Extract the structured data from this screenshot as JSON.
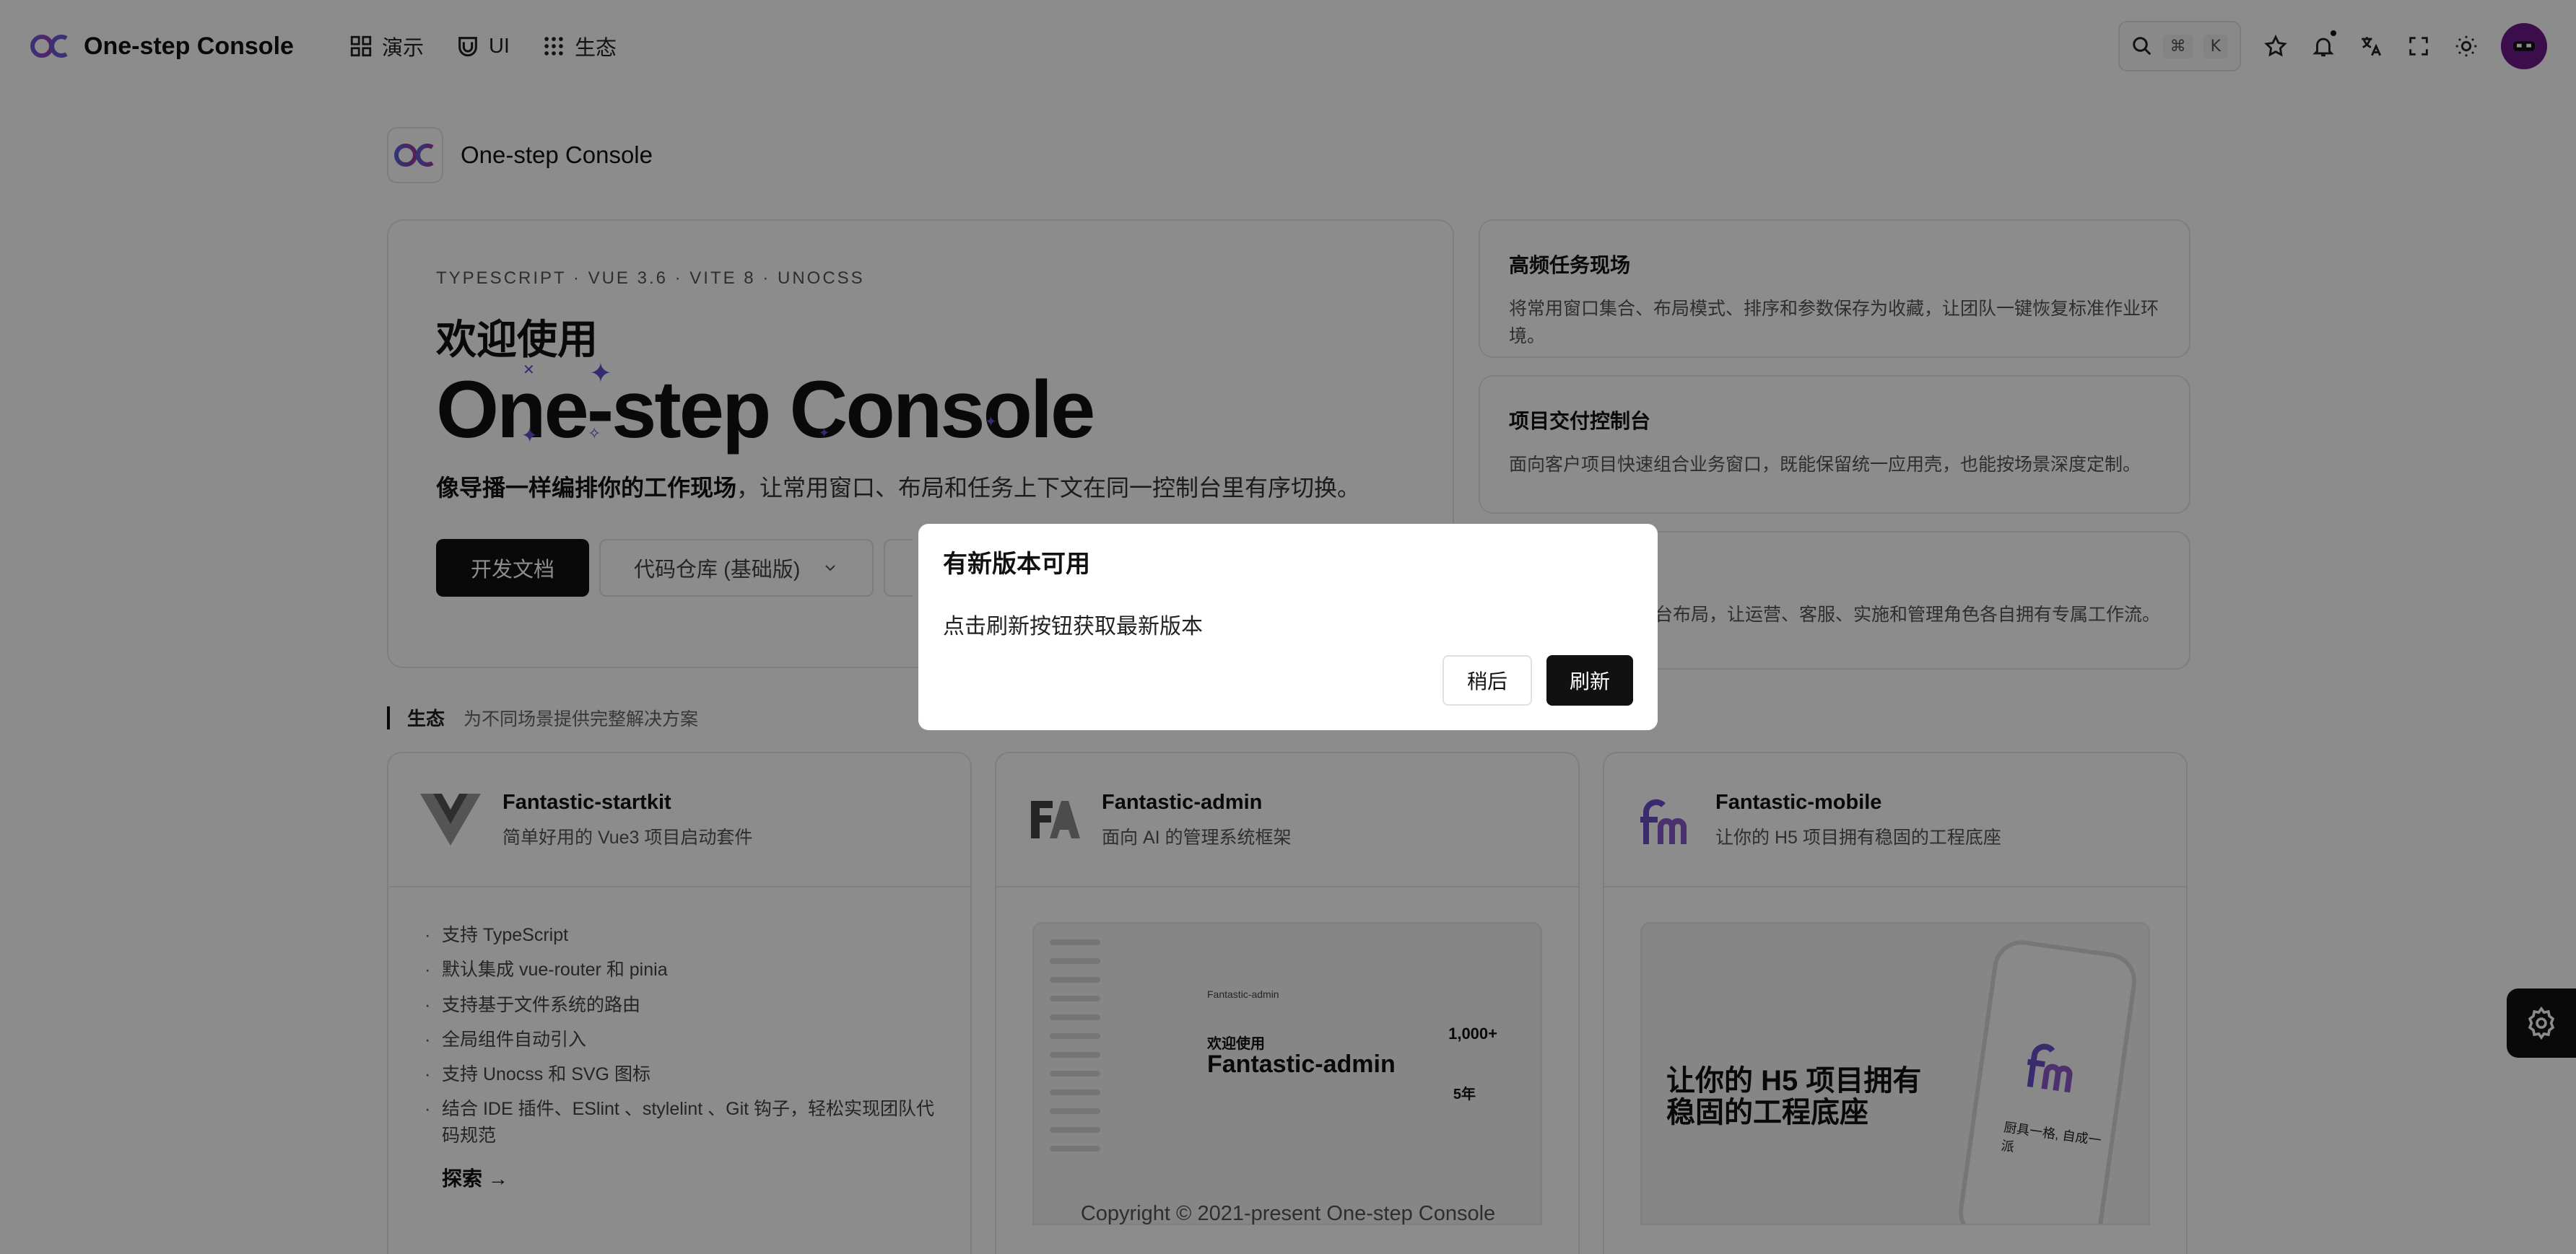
{
  "header": {
    "brand": "One-step Console",
    "nav": [
      {
        "label": "演示",
        "icon": "grid-icon"
      },
      {
        "label": "UI",
        "icon": "shield-icon"
      },
      {
        "label": "生态",
        "icon": "apps-icon"
      }
    ],
    "search_kbd_mod": "⌘",
    "search_kbd_key": "K"
  },
  "logo_title": "One-step Console",
  "hero": {
    "kicker": "TYPESCRIPT · VUE 3.6 · VITE 8 · UNOCSS",
    "welcome": "欢迎使用",
    "title": "One-step Console",
    "desc_bold": "像导播一样编排你的工作现场",
    "desc_rest": "，让常用窗口、布局和任务上下文在同一控制台里有序切换。",
    "btn_docs": "开发文档",
    "btn_repo": "代码仓库 (基础版)"
  },
  "right_cards": [
    {
      "title": "高频任务现场",
      "desc": "将常用窗口集合、布局模式、排序和参数保存为收藏，让团队一键恢复标准作业环境。"
    },
    {
      "title": "项目交付控制台",
      "desc": "面向客户项目快速组合业务窗口，既能保留统一应用壳，也能按场景深度定制。"
    },
    {
      "title": "",
      "desc": "台布局，让运营、客服、实施和管理角色各自拥有专属工作流。"
    }
  ],
  "ecosystem": {
    "title": "生态",
    "subtitle": "为不同场景提供完整解决方案",
    "cards": [
      {
        "name": "Fantastic-startkit",
        "desc": "简单好用的 Vue3 项目启动套件",
        "features": [
          "支持 TypeScript",
          "默认集成 vue-router 和 pinia",
          "支持基于文件系统的路由",
          "全局组件自动引入",
          "支持 Unocss 和 SVG 图标",
          "结合 IDE 插件、ESlint 、stylelint 、Git 钩子，轻松实现团队代码规范"
        ],
        "explore": "探索 →"
      },
      {
        "name": "Fantastic-admin",
        "desc": "面向 AI 的管理系统框架",
        "shot_brand": "Fantastic-admin",
        "shot_welcome": "欢迎使用",
        "shot_title": "Fantastic-admin",
        "shot_stat1": "1,000+",
        "shot_stat2": "5年"
      },
      {
        "name": "Fantastic-mobile",
        "desc": "让你的 H5 项目拥有稳固的工程底座",
        "shot_title_line1": "让你的 H5 项目拥有",
        "shot_title_line2": "稳固的工程底座",
        "phone_caption": "厨具一格, 自成一派"
      }
    ]
  },
  "footer": {
    "copyright": "Copyright",
    "symbol": "©",
    "years": "2021-present",
    "owner": "One-step Console"
  },
  "modal": {
    "title": "有新版本可用",
    "body": "点击刷新按钮获取最新版本",
    "later": "稍后",
    "refresh": "刷新"
  },
  "colors": {
    "accent_dark": "#111111",
    "avatar_bg": "#6d1a8a",
    "sparkle": "#5b53c8"
  }
}
